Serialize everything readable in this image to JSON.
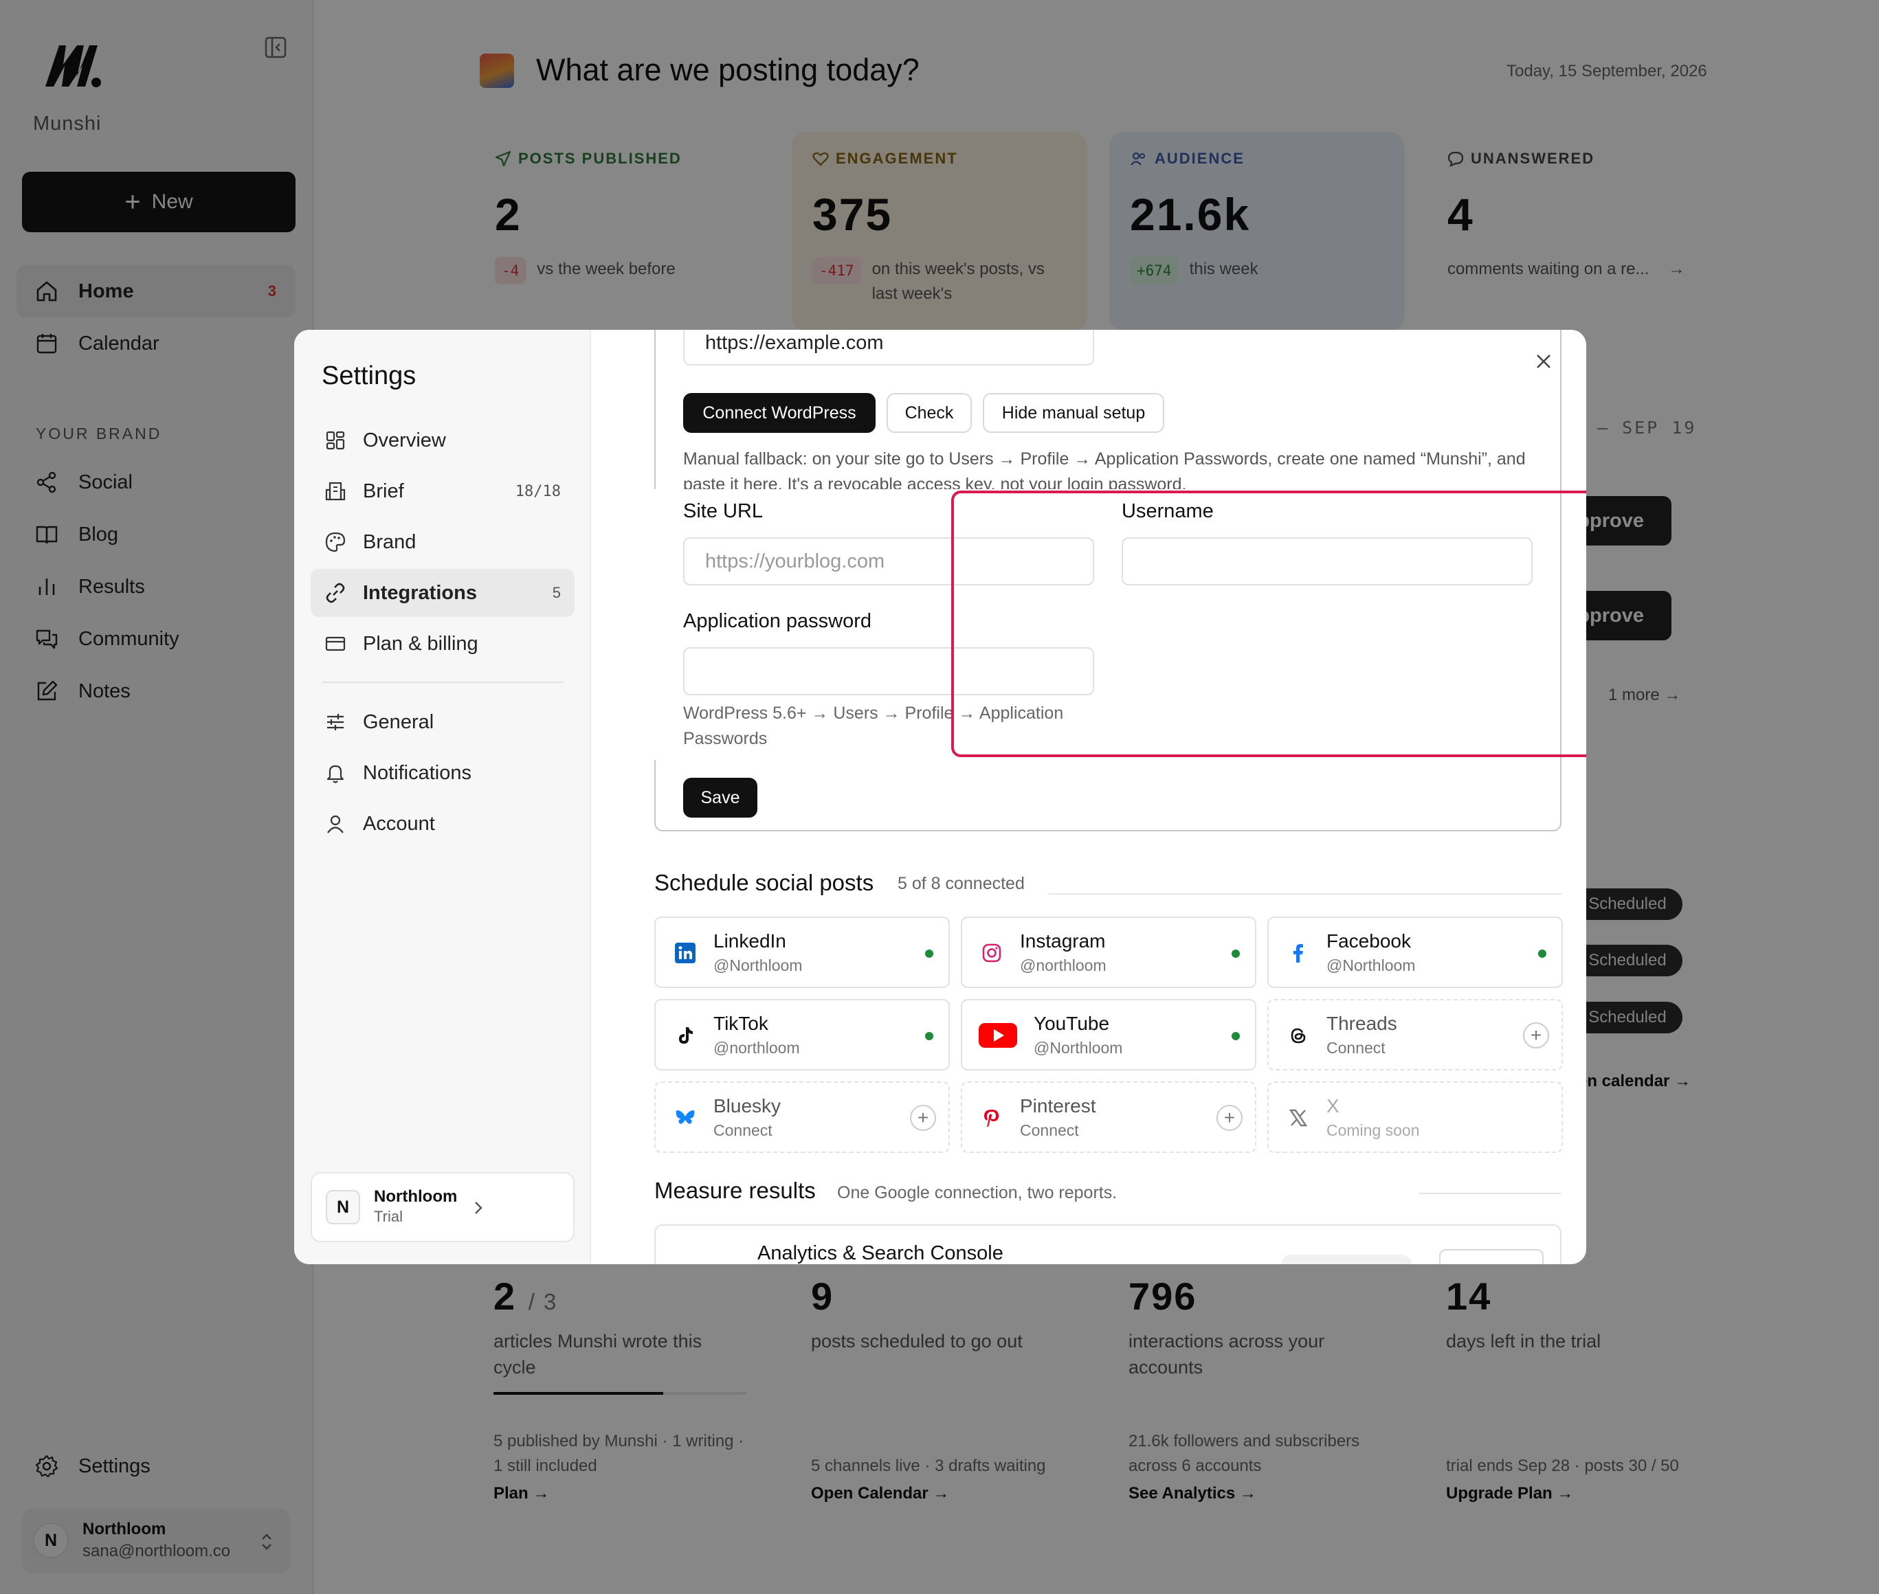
{
  "app": {
    "name": "Munshi"
  },
  "sidebar": {
    "new_label": "New",
    "items": [
      {
        "label": "Home",
        "badge": "3"
      },
      {
        "label": "Calendar"
      }
    ],
    "section_label": "YOUR BRAND",
    "brand_items": [
      {
        "label": "Social"
      },
      {
        "label": "Blog"
      },
      {
        "label": "Results"
      },
      {
        "label": "Community"
      },
      {
        "label": "Notes"
      }
    ],
    "settings_label": "Settings",
    "user": {
      "initial": "N",
      "name": "Northloom",
      "email": "sana@northloom.co"
    }
  },
  "header": {
    "title": "What are we posting today?",
    "date": "Today, 15 September, 2026"
  },
  "stats": [
    {
      "label": "POSTS PUBLISHED",
      "value": "2",
      "delta": "-4",
      "sub": "vs the week before",
      "color": "#2f7a3b"
    },
    {
      "label": "ENGAGEMENT",
      "value": "375",
      "delta": "-417",
      "sub": "on this week's posts, vs last week's",
      "color": "#8a6414"
    },
    {
      "label": "AUDIENCE",
      "value": "21.6k",
      "delta": "+674",
      "sub": "this week",
      "color": "#3b5ea8"
    },
    {
      "label": "UNANSWERED",
      "value": "4",
      "sub": "comments waiting on a re...",
      "color": "#444"
    }
  ],
  "right_panel": {
    "date": "– SEP 19",
    "approve_label": "pprove",
    "more": "1 more",
    "scheduled_label": "Scheduled",
    "calendar_link": "en calendar →"
  },
  "bottom_cards": [
    {
      "value": "2",
      "value_suffix": "/ 3",
      "desc": "articles Munshi wrote this cycle",
      "foot": "5 published by Munshi · 1 writing · 1 still included",
      "link": "Plan →",
      "progress": 0.67
    },
    {
      "value": "9",
      "desc": "posts scheduled to go out",
      "foot": "5 channels live · 3 drafts waiting",
      "link": "Open Calendar →"
    },
    {
      "value": "796",
      "desc": "interactions across your accounts",
      "foot": "21.6k followers and subscribers across 6 accounts",
      "link": "See Analytics →"
    },
    {
      "value": "14",
      "desc": "days left in the trial",
      "foot": "trial ends Sep 28 · posts 30 / 50",
      "link": "Upgrade Plan →"
    }
  ],
  "settings": {
    "title": "Settings",
    "nav": [
      {
        "label": "Overview"
      },
      {
        "label": "Brief",
        "count": "18/18"
      },
      {
        "label": "Brand"
      },
      {
        "label": "Integrations",
        "count": "5"
      },
      {
        "label": "Plan & billing"
      },
      {
        "label": "General"
      },
      {
        "label": "Notifications"
      },
      {
        "label": "Account"
      }
    ],
    "org": {
      "initial": "N",
      "name": "Northloom",
      "plan": "Trial"
    },
    "wordpress": {
      "url_value": "https://example.com",
      "connect_label": "Connect WordPress",
      "check_label": "Check",
      "hide_label": "Hide manual setup",
      "fallback": "Manual fallback: on your site go to Users → Profile → Application Passwords, create one named “Munshi”, and paste it here. It's a revocable access key, not your login password.",
      "site_url_label": "Site URL",
      "site_url_placeholder": "https://yourblog.com",
      "username_label": "Username",
      "username_value": "",
      "app_password_label": "Application password",
      "app_password_value": "",
      "hint": "WordPress 5.6+ → Users → Profile → Application Passwords",
      "save_label": "Save"
    },
    "social": {
      "title": "Schedule social posts",
      "subtitle": "5 of 8 connected",
      "accounts": [
        {
          "name": "LinkedIn",
          "handle": "@Northloom",
          "status": "connected"
        },
        {
          "name": "Instagram",
          "handle": "@northloom",
          "status": "connected"
        },
        {
          "name": "Facebook",
          "handle": "@Northloom",
          "status": "connected"
        },
        {
          "name": "TikTok",
          "handle": "@northloom",
          "status": "connected"
        },
        {
          "name": "YouTube",
          "handle": "@Northloom",
          "status": "connected"
        },
        {
          "name": "Threads",
          "handle": "Connect",
          "status": "available"
        },
        {
          "name": "Bluesky",
          "handle": "Connect",
          "status": "available"
        },
        {
          "name": "Pinterest",
          "handle": "Connect",
          "status": "available"
        },
        {
          "name": "X",
          "handle": "Coming soon",
          "status": "disabled"
        }
      ]
    },
    "results": {
      "title": "Measure results",
      "subtitle": "One Google connection, two reports.",
      "card_title": "Analytics & Search Console"
    }
  },
  "colors": {
    "accent_highlight": "#d81b52",
    "connected_dot": "#1f8a3a"
  }
}
